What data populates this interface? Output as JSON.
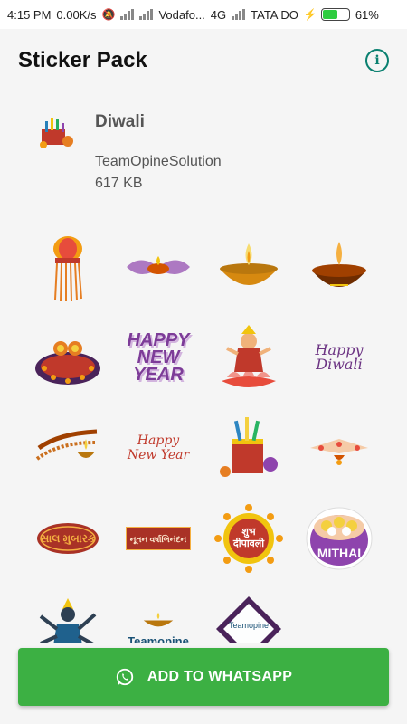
{
  "status_bar": {
    "time": "4:15 PM",
    "speed": "0.00K/s",
    "carrier1": "Vodafo...",
    "network": "4G",
    "carrier2": "TATA DO",
    "battery": "61%",
    "battery_level": 0.61
  },
  "appbar": {
    "title": "Sticker Pack",
    "info_icon": "info-icon"
  },
  "pack": {
    "name": "Diwali",
    "publisher": "TeamOpineSolution",
    "size": "617 KB"
  },
  "stickers": [
    {
      "name": "kandil-lantern",
      "icon": "lantern-icon"
    },
    {
      "name": "diya-ornament",
      "icon": "ornament-icon"
    },
    {
      "name": "diya-lamp-gold",
      "icon": "diya-icon"
    },
    {
      "name": "diya-lamp-brown",
      "icon": "diya-icon"
    },
    {
      "name": "decorated-diya-plate",
      "icon": "plate-icon"
    },
    {
      "name": "happy-new-year-3d",
      "text": "HAPPY NEW YEAR"
    },
    {
      "name": "goddess-lakshmi",
      "icon": "lakshmi-icon"
    },
    {
      "name": "happy-diwali-text",
      "text": "Happy Diwali"
    },
    {
      "name": "diya-row",
      "icon": "diya-row-icon"
    },
    {
      "name": "happy-new-year-script",
      "text": "Happy New Year"
    },
    {
      "name": "firecrackers",
      "icon": "firecracker-icon"
    },
    {
      "name": "diya-decoration",
      "icon": "decoration-icon"
    },
    {
      "name": "saal-mubarak",
      "text": "સાલ મુબારક"
    },
    {
      "name": "nutan-varshabhinandan",
      "text": "નૂતન વર્ષાભિનંદન"
    },
    {
      "name": "shubh-deepavali",
      "text": "शुभ दीपावली"
    },
    {
      "name": "mithai",
      "text": "MITHAI"
    },
    {
      "name": "goddess-kali",
      "icon": "kali-icon"
    },
    {
      "name": "teamopine-diya",
      "text": "Teamopine"
    },
    {
      "name": "teamopine-rangoli",
      "text": "Teamopine"
    }
  ],
  "cta": {
    "label": "ADD TO WHATSAPP",
    "icon": "whatsapp-icon",
    "color": "#3cb043"
  }
}
